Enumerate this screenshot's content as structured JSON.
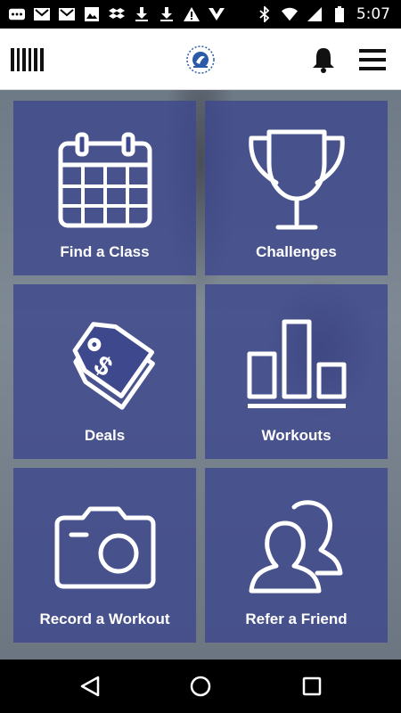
{
  "status_bar": {
    "time": "5:07",
    "notification_icons": [
      "more-icon",
      "gmail-icon",
      "gmail-icon",
      "image-icon",
      "dropbox-icon",
      "download-icon",
      "download-icon",
      "warning-icon",
      "ymca-icon"
    ],
    "system_icons": [
      "bluetooth-icon",
      "wifi-icon",
      "cellular-signal-icon",
      "battery-icon"
    ]
  },
  "app_bar": {
    "left_icon": "barcode-icon",
    "center_icon": "ymca-logo",
    "right_icons": [
      "bell-icon",
      "menu-icon"
    ]
  },
  "tiles": [
    {
      "label": "Find a Class",
      "icon": "calendar-icon"
    },
    {
      "label": "Challenges",
      "icon": "trophy-icon"
    },
    {
      "label": "Deals",
      "icon": "price-tag-icon"
    },
    {
      "label": "Workouts",
      "icon": "bar-chart-icon"
    },
    {
      "label": "Record a Workout",
      "icon": "camera-icon"
    },
    {
      "label": "Refer a Friend",
      "icon": "users-icon"
    }
  ],
  "nav_bar": {
    "buttons": [
      "back-icon",
      "home-icon",
      "recents-icon"
    ]
  },
  "colors": {
    "tile_bg": "#3e488c",
    "app_bar_bg": "#ffffff",
    "status_bar_bg": "#000000"
  }
}
